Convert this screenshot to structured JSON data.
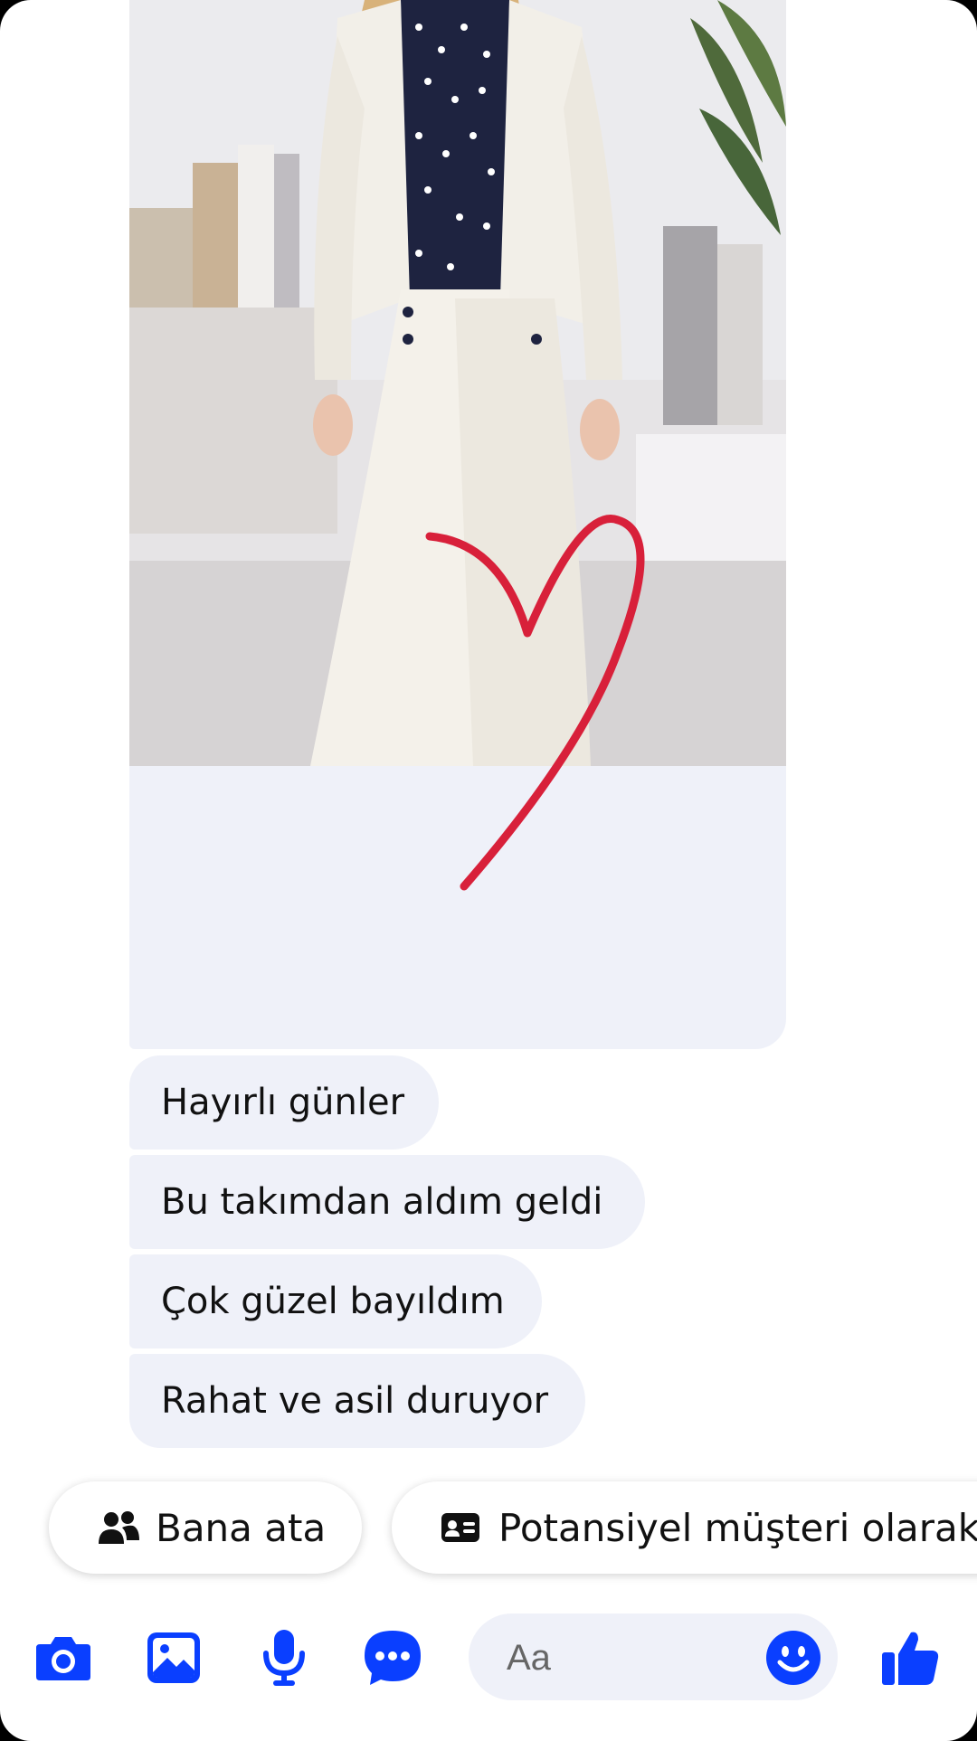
{
  "messages": [
    {
      "text": "Hayırlı günler"
    },
    {
      "text": "Bu takımdan aldım geldi"
    },
    {
      "text": "Çok güzel bayıldım"
    },
    {
      "text": "Rahat ve asil duruyor"
    }
  ],
  "quick_actions": [
    {
      "label": "Bana ata",
      "icon": "people-icon"
    },
    {
      "label": "Potansiyel müşteri olarak",
      "icon": "contact-card-icon"
    }
  ],
  "composer": {
    "placeholder": "Aa",
    "tools": [
      "camera-icon",
      "gallery-icon",
      "microphone-icon",
      "more-icon"
    ],
    "emoji_icon": "smiley-icon",
    "send_icon": "thumbs-up-icon"
  },
  "colors": {
    "accent": "#0a3fff",
    "bubble": "#eff1f9",
    "heart": "#d8203a"
  }
}
